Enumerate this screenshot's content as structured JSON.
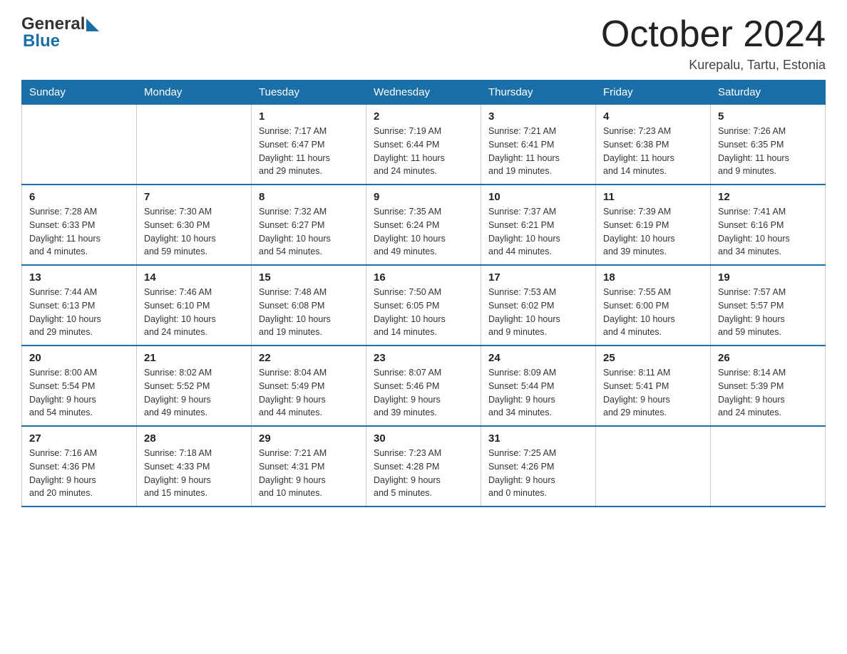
{
  "header": {
    "logo_general": "General",
    "logo_blue": "Blue",
    "month_title": "October 2024",
    "location": "Kurepalu, Tartu, Estonia"
  },
  "weekdays": [
    "Sunday",
    "Monday",
    "Tuesday",
    "Wednesday",
    "Thursday",
    "Friday",
    "Saturday"
  ],
  "weeks": [
    [
      {
        "day": "",
        "info": ""
      },
      {
        "day": "",
        "info": ""
      },
      {
        "day": "1",
        "info": "Sunrise: 7:17 AM\nSunset: 6:47 PM\nDaylight: 11 hours\nand 29 minutes."
      },
      {
        "day": "2",
        "info": "Sunrise: 7:19 AM\nSunset: 6:44 PM\nDaylight: 11 hours\nand 24 minutes."
      },
      {
        "day": "3",
        "info": "Sunrise: 7:21 AM\nSunset: 6:41 PM\nDaylight: 11 hours\nand 19 minutes."
      },
      {
        "day": "4",
        "info": "Sunrise: 7:23 AM\nSunset: 6:38 PM\nDaylight: 11 hours\nand 14 minutes."
      },
      {
        "day": "5",
        "info": "Sunrise: 7:26 AM\nSunset: 6:35 PM\nDaylight: 11 hours\nand 9 minutes."
      }
    ],
    [
      {
        "day": "6",
        "info": "Sunrise: 7:28 AM\nSunset: 6:33 PM\nDaylight: 11 hours\nand 4 minutes."
      },
      {
        "day": "7",
        "info": "Sunrise: 7:30 AM\nSunset: 6:30 PM\nDaylight: 10 hours\nand 59 minutes."
      },
      {
        "day": "8",
        "info": "Sunrise: 7:32 AM\nSunset: 6:27 PM\nDaylight: 10 hours\nand 54 minutes."
      },
      {
        "day": "9",
        "info": "Sunrise: 7:35 AM\nSunset: 6:24 PM\nDaylight: 10 hours\nand 49 minutes."
      },
      {
        "day": "10",
        "info": "Sunrise: 7:37 AM\nSunset: 6:21 PM\nDaylight: 10 hours\nand 44 minutes."
      },
      {
        "day": "11",
        "info": "Sunrise: 7:39 AM\nSunset: 6:19 PM\nDaylight: 10 hours\nand 39 minutes."
      },
      {
        "day": "12",
        "info": "Sunrise: 7:41 AM\nSunset: 6:16 PM\nDaylight: 10 hours\nand 34 minutes."
      }
    ],
    [
      {
        "day": "13",
        "info": "Sunrise: 7:44 AM\nSunset: 6:13 PM\nDaylight: 10 hours\nand 29 minutes."
      },
      {
        "day": "14",
        "info": "Sunrise: 7:46 AM\nSunset: 6:10 PM\nDaylight: 10 hours\nand 24 minutes."
      },
      {
        "day": "15",
        "info": "Sunrise: 7:48 AM\nSunset: 6:08 PM\nDaylight: 10 hours\nand 19 minutes."
      },
      {
        "day": "16",
        "info": "Sunrise: 7:50 AM\nSunset: 6:05 PM\nDaylight: 10 hours\nand 14 minutes."
      },
      {
        "day": "17",
        "info": "Sunrise: 7:53 AM\nSunset: 6:02 PM\nDaylight: 10 hours\nand 9 minutes."
      },
      {
        "day": "18",
        "info": "Sunrise: 7:55 AM\nSunset: 6:00 PM\nDaylight: 10 hours\nand 4 minutes."
      },
      {
        "day": "19",
        "info": "Sunrise: 7:57 AM\nSunset: 5:57 PM\nDaylight: 9 hours\nand 59 minutes."
      }
    ],
    [
      {
        "day": "20",
        "info": "Sunrise: 8:00 AM\nSunset: 5:54 PM\nDaylight: 9 hours\nand 54 minutes."
      },
      {
        "day": "21",
        "info": "Sunrise: 8:02 AM\nSunset: 5:52 PM\nDaylight: 9 hours\nand 49 minutes."
      },
      {
        "day": "22",
        "info": "Sunrise: 8:04 AM\nSunset: 5:49 PM\nDaylight: 9 hours\nand 44 minutes."
      },
      {
        "day": "23",
        "info": "Sunrise: 8:07 AM\nSunset: 5:46 PM\nDaylight: 9 hours\nand 39 minutes."
      },
      {
        "day": "24",
        "info": "Sunrise: 8:09 AM\nSunset: 5:44 PM\nDaylight: 9 hours\nand 34 minutes."
      },
      {
        "day": "25",
        "info": "Sunrise: 8:11 AM\nSunset: 5:41 PM\nDaylight: 9 hours\nand 29 minutes."
      },
      {
        "day": "26",
        "info": "Sunrise: 8:14 AM\nSunset: 5:39 PM\nDaylight: 9 hours\nand 24 minutes."
      }
    ],
    [
      {
        "day": "27",
        "info": "Sunrise: 7:16 AM\nSunset: 4:36 PM\nDaylight: 9 hours\nand 20 minutes."
      },
      {
        "day": "28",
        "info": "Sunrise: 7:18 AM\nSunset: 4:33 PM\nDaylight: 9 hours\nand 15 minutes."
      },
      {
        "day": "29",
        "info": "Sunrise: 7:21 AM\nSunset: 4:31 PM\nDaylight: 9 hours\nand 10 minutes."
      },
      {
        "day": "30",
        "info": "Sunrise: 7:23 AM\nSunset: 4:28 PM\nDaylight: 9 hours\nand 5 minutes."
      },
      {
        "day": "31",
        "info": "Sunrise: 7:25 AM\nSunset: 4:26 PM\nDaylight: 9 hours\nand 0 minutes."
      },
      {
        "day": "",
        "info": ""
      },
      {
        "day": "",
        "info": ""
      }
    ]
  ]
}
